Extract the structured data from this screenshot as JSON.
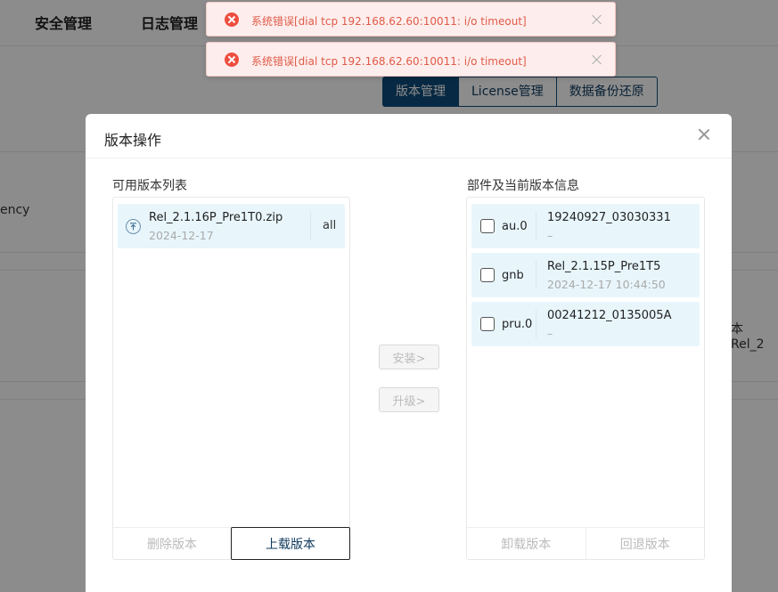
{
  "topnav": {
    "items": [
      "安全管理",
      "日志管理"
    ]
  },
  "bg_tabs": [
    "版本管理",
    "License管理",
    "数据备份还原"
  ],
  "bg_fragments": {
    "left_text": "ency",
    "right_text": "本 Rel_2"
  },
  "toasts": [
    {
      "message": "系统错误[dial tcp 192.168.62.60:10011: i/o timeout]"
    },
    {
      "message": "系统错误[dial tcp 192.168.62.60:10011: i/o timeout]"
    }
  ],
  "modal": {
    "title": "版本操作",
    "available_label": "可用版本列表",
    "components_label": "部件及当前版本信息",
    "versions": [
      {
        "name": "Rel_2.1.16P_Pre1T0.zip",
        "date": "2024-12-17",
        "tag": "all",
        "icon": "upload-file-icon"
      }
    ],
    "components": [
      {
        "name": "au.0",
        "version": "19240927_03030331",
        "sub": "–"
      },
      {
        "name": "gnb",
        "version": "Rel_2.1.15P_Pre1T5",
        "sub": "2024-12-17 10:44:50"
      },
      {
        "name": "pru.0",
        "version": "00241212_0135005A",
        "sub": "–"
      }
    ],
    "install_label": "安装>",
    "upgrade_label": "升级>",
    "delete_label": "删除版本",
    "upload_label": "上载版本",
    "uninstall_label": "卸载版本",
    "rollback_label": "回退版本"
  },
  "colors": {
    "accent": "#0e4b7a",
    "error": "#ed4e3f",
    "item_bg": "#e8f6fc"
  }
}
